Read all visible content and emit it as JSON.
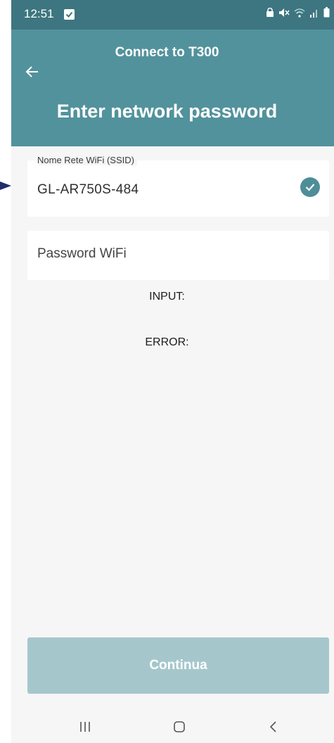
{
  "status_bar": {
    "time": "12:51",
    "icons": [
      "checkbox-notification-icon",
      "lock-icon",
      "mute-icon",
      "wifi-icon",
      "signal-icon",
      "battery-icon"
    ]
  },
  "app_bar": {
    "title": "Connect to T300",
    "back_icon": "arrow-left-icon"
  },
  "header": {
    "headline": "Enter network password"
  },
  "form": {
    "ssid": {
      "label": "Nome Rete WiFi (SSID)",
      "value": "GL-AR750S-484",
      "status_icon": "check-circle-icon"
    },
    "password": {
      "placeholder": "Password WiFi",
      "value": ""
    },
    "input_label": "INPUT:",
    "error_label": "ERROR:"
  },
  "actions": {
    "continue_label": "Continua"
  },
  "nav_bar": {
    "items": [
      "recent-apps-icon",
      "home-icon",
      "back-icon"
    ]
  },
  "colors": {
    "status_bar": "#3d7680",
    "app_bar": "#52929c",
    "button_disabled": "#a5c7cc",
    "pointer_arrow": "#1f2d6b"
  }
}
